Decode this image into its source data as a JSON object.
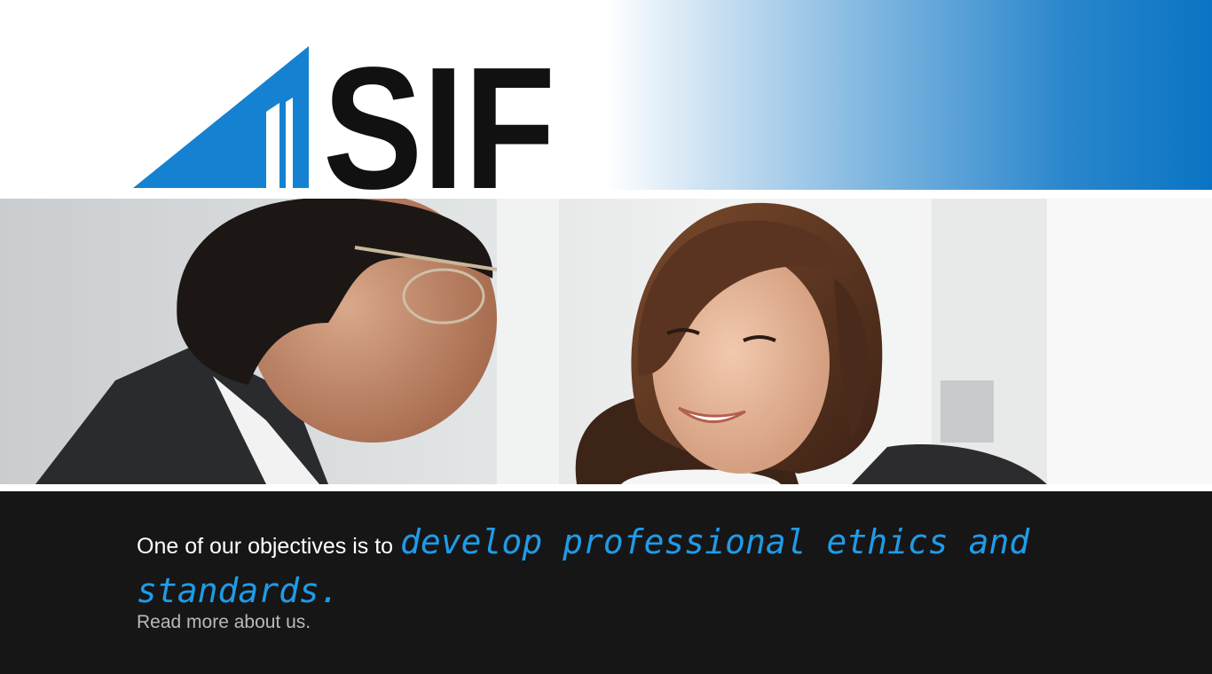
{
  "header": {
    "logo_text": "SIF",
    "brand_color": "#1582d1",
    "gradient_end": "#0a74c4"
  },
  "hero": {
    "image": "photo-two-business-people-talking"
  },
  "banner": {
    "lead_text": "One of our objectives is to",
    "highlight_text": "develop professional ethics and standards.",
    "read_more": "Read more about us.",
    "highlight_color": "#1f9be8",
    "background": "#161616"
  }
}
